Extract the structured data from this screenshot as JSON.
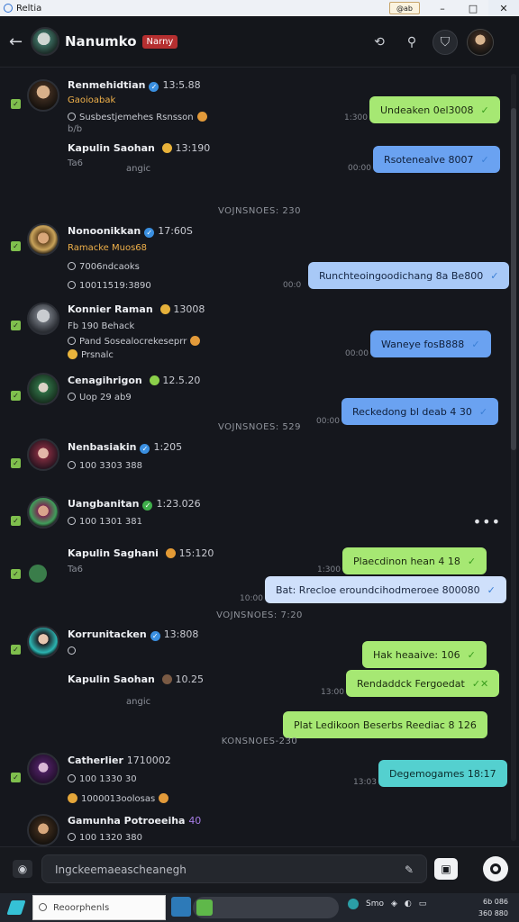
{
  "window": {
    "title": "Reltia",
    "tag": "@ab",
    "minimize": "–",
    "maximize": "□",
    "close": "✕"
  },
  "header": {
    "back_icon": "arrow-left-icon",
    "title": "Nanumko",
    "badge": "Narny",
    "icons": [
      "share-icon",
      "search-icon",
      "shield-icon",
      "profile-avatar"
    ]
  },
  "messages": [
    {
      "name": "Renmehidtian",
      "time": "13:5.88",
      "line1": "Gaoioabak",
      "line2": "Susbestjemehes Rsnsson",
      "line3": "b/b",
      "line4": "Kapulin Saohan",
      "line4_time": "13:190",
      "line5": "Ta6",
      "line6": "angic"
    },
    {
      "name": "Nonoonikkan",
      "time": "17:60S",
      "line1": "Ramacke Muos68",
      "line2": "7006ndcaoks",
      "line3": "10011519:3890"
    },
    {
      "name": "Konnier Raman",
      "time": "13008",
      "line1": "Fb 190 Behack",
      "line2": "Pand Sosealocrekeseprr",
      "line3": "Prsnalc"
    },
    {
      "name": "Cenagihrigon",
      "time": "12.5.20",
      "line1": "Uop 29 ab9"
    },
    {
      "name": "Nenbasiakin",
      "time": "1:205",
      "line1": "100 3303 388"
    },
    {
      "name": "Uangbanitan",
      "time": "1:23.026",
      "line1": "100 1301 381"
    },
    {
      "name": "Kapulin Saghani",
      "time": "15:120",
      "line1": "Ta6"
    },
    {
      "name": "Korrunitacken",
      "time": "13:808",
      "line1": "Kapulin Saohan",
      "line1_time": "10.25",
      "line2": "angic"
    },
    {
      "name": "Catherlier",
      "time": "1710002",
      "line1": "100 1330 30",
      "line2": "1000013oolosas"
    },
    {
      "name": "Gamunha Potroeeiha",
      "time": "40",
      "line1": "100 1320 380"
    }
  ],
  "dividers": [
    "VOJNSNOES: 230",
    "VOJNSNOES: 529",
    "VOJNSNOES: 7:20",
    "KONSNOES-230"
  ],
  "bubbles": [
    {
      "text": "Undeaken 0el3008",
      "stamp": "1:300",
      "color": "green"
    },
    {
      "text": "Rsotenealve 8007",
      "stamp": "00:00",
      "color": "blue"
    },
    {
      "text": "Runchteoingoodichang 8a Be800",
      "stamp": "00:0",
      "color": "light"
    },
    {
      "text": "Waneye fosB888",
      "stamp": "00:00",
      "color": "blue"
    },
    {
      "text": "Reckedong bl deab 4 30",
      "stamp": "00:00",
      "color": "blue"
    },
    {
      "text": "Plaecdinon hean 4 18",
      "stamp": "1:300",
      "color": "green"
    },
    {
      "text": "Bat: Rrecloe eroundcihodmeroee 800080",
      "stamp": "10:00",
      "color": "pale"
    },
    {
      "text": "Hak heaaive: 106",
      "stamp": "",
      "color": "green"
    },
    {
      "text": "Rendaddck Fergoedat",
      "stamp": "13:00",
      "color": "green"
    },
    {
      "text": "Plat Ledikoon Beserbs Reediac 8 126",
      "stamp": "",
      "color": "green"
    },
    {
      "text": "Degemogames 18:17",
      "stamp": "13:03",
      "color": "teal"
    }
  ],
  "composer": {
    "placeholder": "Ingckeemaeascheanegh"
  },
  "taskbar": {
    "search": "Reoorphenls",
    "tray1": "Smo",
    "clock_line1": "6b 086",
    "clock_line2": "360 880"
  },
  "colors": {
    "background": "#15171d",
    "bubble_green": "#a6e873",
    "bubble_blue": "#6aa2f1",
    "bubble_teal": "#54d0cf",
    "badge_red": "#b52f30"
  }
}
